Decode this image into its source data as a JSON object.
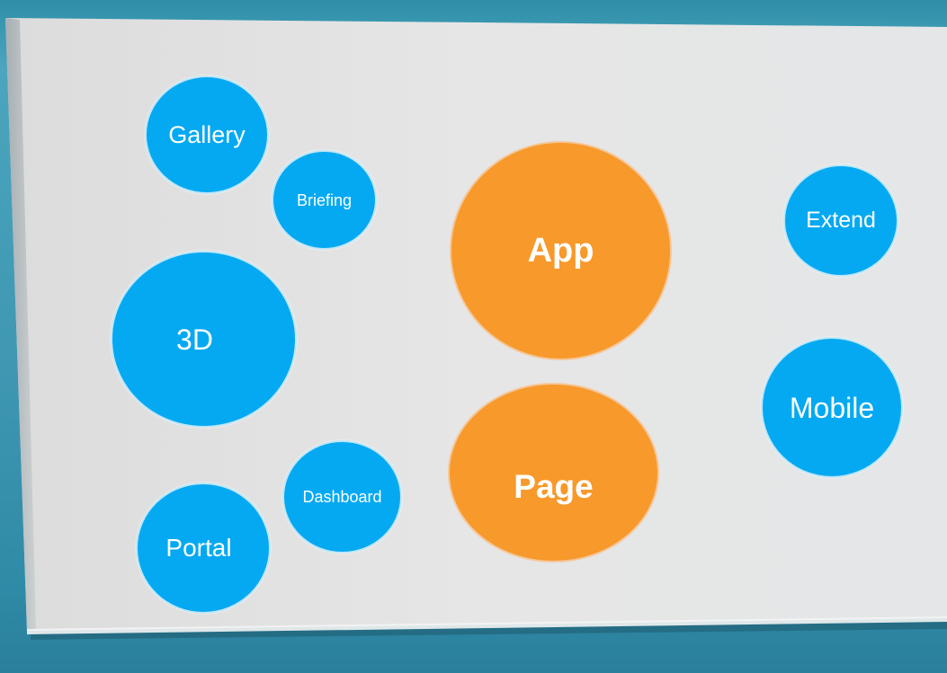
{
  "colors": {
    "bubble_blue": "#04a9f1",
    "bubble_orange": "#f7992b",
    "board_light": "#e6e6e6",
    "frame_teal": "#3f97b2"
  },
  "bubbles": {
    "gallery": "Gallery",
    "briefing": "Briefing",
    "three_d": "3D",
    "dashboard": "Dashboard",
    "portal": "Portal",
    "app": "App",
    "page": "Page",
    "extend": "Extend",
    "mobile": "Mobile"
  }
}
